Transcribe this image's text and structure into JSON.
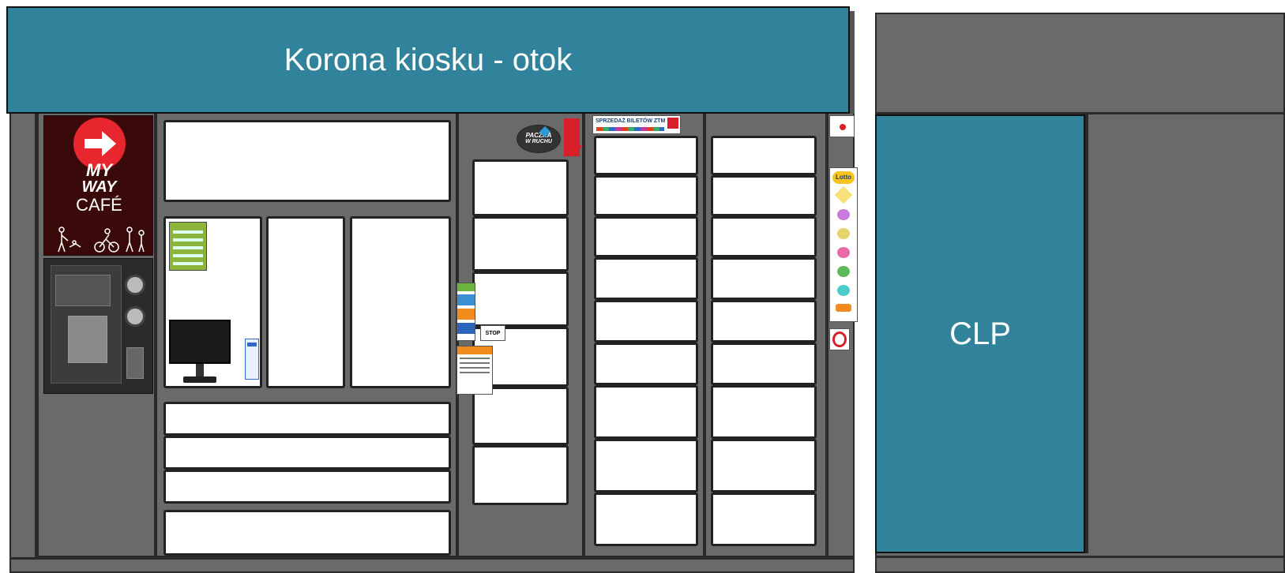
{
  "header": {
    "title": "Korona kiosku - otok"
  },
  "clp": {
    "label": "CLP"
  },
  "signs": {
    "cafe_line1": "MY",
    "cafe_line2": "WAY",
    "cafe_line3": "CAFÉ",
    "paczka_line1": "PACZKA",
    "paczka_line2": "W RUCHU",
    "tickets": "SPRZEDAŻ BILETÓW ZTM",
    "lotto": "Lotto",
    "stop": "STOP"
  },
  "colors": {
    "teal": "#31839b",
    "frame_gray": "#6a6a6a",
    "cafe_red": "#e8262d",
    "cafe_bg": "#3a0a0a"
  }
}
